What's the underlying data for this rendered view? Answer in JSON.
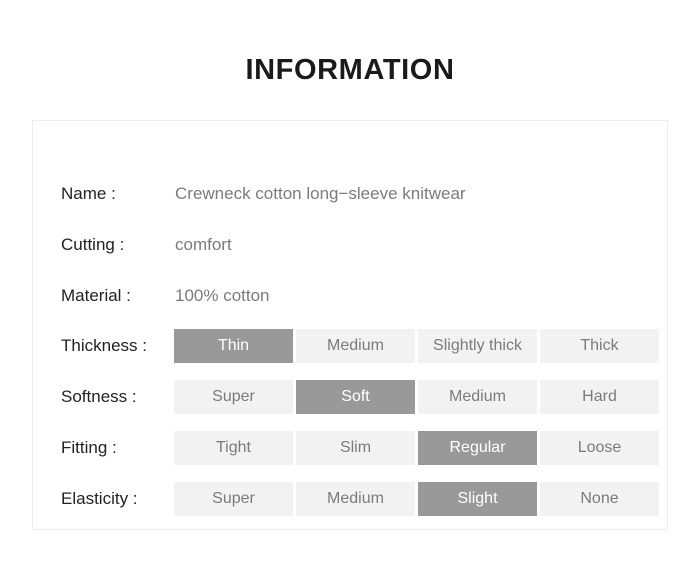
{
  "page": {
    "title": "INFORMATION"
  },
  "colors": {
    "title_text": "#1a1a1a",
    "label_text": "#222222",
    "value_text": "#7b7b7b",
    "card_border": "#ededed",
    "option_unselected_bg": "#f2f2f2",
    "option_unselected_text": "#7b7b7b",
    "option_selected_bg": "#999999",
    "option_selected_text": "#ffffff",
    "page_background": "#ffffff"
  },
  "info": {
    "text_rows": [
      {
        "label": "Name :",
        "value": "Crewneck cotton long−sleeve knitwear"
      },
      {
        "label": "Cutting :",
        "value": "comfort"
      },
      {
        "label": "Material :",
        "value": "100% cotton"
      }
    ],
    "option_rows": [
      {
        "label": "Thickness :",
        "selected_index": 0,
        "selected_value": "Thin",
        "options": [
          "Thin",
          "Medium",
          "Slightly thick",
          "Thick"
        ]
      },
      {
        "label": "Softness :",
        "selected_index": 1,
        "selected_value": "Soft",
        "options": [
          "Super",
          "Soft",
          "Medium",
          "Hard"
        ]
      },
      {
        "label": "Fitting :",
        "selected_index": 2,
        "selected_value": "Regular",
        "options": [
          "Tight",
          "Slim",
          "Regular",
          "Loose"
        ]
      },
      {
        "label": "Elasticity :",
        "selected_index": 2,
        "selected_value": "Slight",
        "options": [
          "Super",
          "Medium",
          "Slight",
          "None"
        ]
      }
    ]
  }
}
